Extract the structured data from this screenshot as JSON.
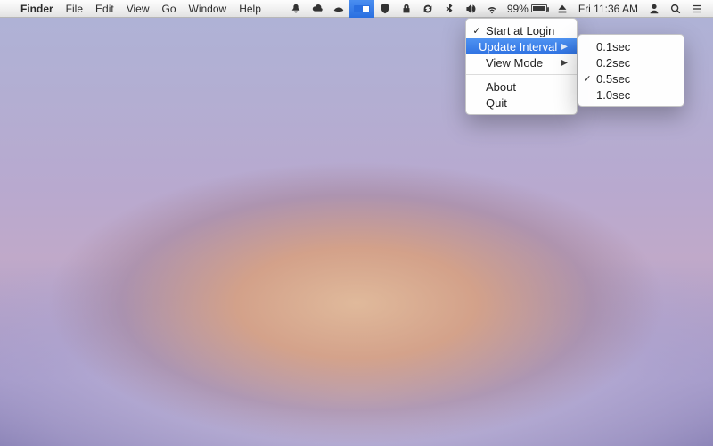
{
  "menubar": {
    "app_name": "Finder",
    "items": [
      "File",
      "Edit",
      "View",
      "Go",
      "Window",
      "Help"
    ],
    "battery_percent": "99%",
    "clock": "Fri 11:36 AM"
  },
  "menubar_icons": [
    "notification-bell-icon",
    "cloud-icon",
    "hat-icon",
    "app-progress-icon",
    "shield-icon",
    "lock-icon",
    "sync-icon",
    "bluetooth-icon",
    "volume-icon",
    "wifi-icon",
    "battery-icon",
    "eject-icon",
    "clock",
    "user-icon",
    "magnify-icon",
    "list-icon"
  ],
  "dropdown": {
    "items": [
      {
        "label": "Start at Login",
        "checked": true,
        "submenu": false
      },
      {
        "label": "Update Interval",
        "checked": false,
        "submenu": true,
        "highlight": true
      },
      {
        "label": "View Mode",
        "checked": false,
        "submenu": true
      }
    ],
    "items2": [
      {
        "label": "About"
      },
      {
        "label": "Quit"
      }
    ]
  },
  "submenu": {
    "items": [
      {
        "label": "0.1sec",
        "checked": false
      },
      {
        "label": "0.2sec",
        "checked": false
      },
      {
        "label": "0.5sec",
        "checked": true
      },
      {
        "label": "1.0sec",
        "checked": false
      }
    ]
  }
}
